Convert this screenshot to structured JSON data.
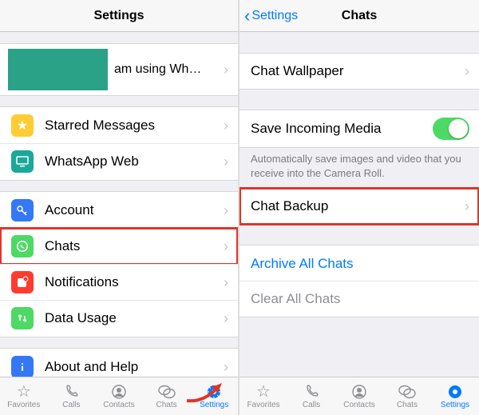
{
  "left": {
    "title": "Settings",
    "profile_status": "am using Wh…",
    "rows": {
      "starred": "Starred Messages",
      "web": "WhatsApp Web",
      "account": "Account",
      "chats": "Chats",
      "notifications": "Notifications",
      "data": "Data Usage",
      "help": "About and Help"
    },
    "tabs": {
      "favorites": "Favorites",
      "calls": "Calls",
      "contacts": "Contacts",
      "chats": "Chats",
      "settings": "Settings"
    }
  },
  "right": {
    "back": "Settings",
    "title": "Chats",
    "rows": {
      "wallpaper": "Chat Wallpaper",
      "save_media": "Save Incoming Media",
      "save_media_footnote": "Automatically save images and video that you receive into the Camera Roll.",
      "backup": "Chat Backup",
      "archive": "Archive All Chats",
      "clear": "Clear All Chats"
    },
    "toggles": {
      "save_media": true
    },
    "tabs": {
      "favorites": "Favorites",
      "calls": "Calls",
      "contacts": "Contacts",
      "chats": "Chats",
      "settings": "Settings"
    }
  },
  "colors": {
    "accent": "#007aff",
    "toggle_on": "#4cd964",
    "highlight": "#e0352a"
  }
}
